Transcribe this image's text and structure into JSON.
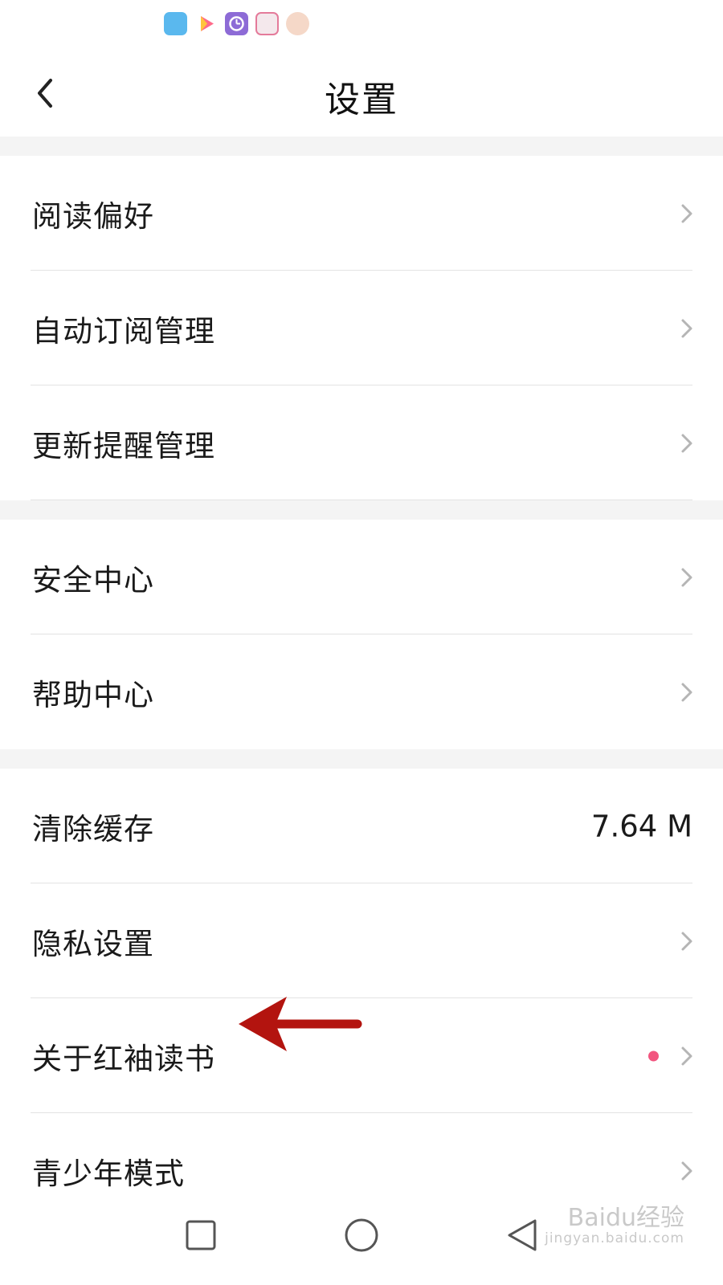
{
  "status_bar": {
    "icons": [
      "shield-app-icon",
      "video-app-icon",
      "clock-app-icon",
      "reading-app-icon",
      "avatar-app-icon"
    ]
  },
  "header": {
    "title": "设置",
    "back_icon": "chevron-left-icon"
  },
  "sections": [
    {
      "items": [
        {
          "label": "阅读偏好",
          "trailing": "chevron"
        },
        {
          "label": "自动订阅管理",
          "trailing": "chevron"
        },
        {
          "label": "更新提醒管理",
          "trailing": "chevron"
        }
      ]
    },
    {
      "items": [
        {
          "label": "安全中心",
          "trailing": "chevron"
        },
        {
          "label": "帮助中心",
          "trailing": "chevron"
        }
      ]
    },
    {
      "items": [
        {
          "label": "清除缓存",
          "value": "7.64 M"
        },
        {
          "label": "隐私设置",
          "trailing": "chevron"
        },
        {
          "label": "关于红袖读书",
          "trailing": "chevron",
          "badge": "dot"
        },
        {
          "label": "青少年模式",
          "trailing": "chevron"
        }
      ]
    }
  ],
  "colors": {
    "badge": "#f2557f",
    "annotation_arrow": "#b3140f",
    "section_gap": "#f4f4f4"
  },
  "nav_bar": {
    "icons": [
      "recents-square-icon",
      "home-circle-icon",
      "back-triangle-icon"
    ]
  },
  "watermark": {
    "main": "Baidu经验",
    "sub": "jingyan.baidu.com"
  }
}
